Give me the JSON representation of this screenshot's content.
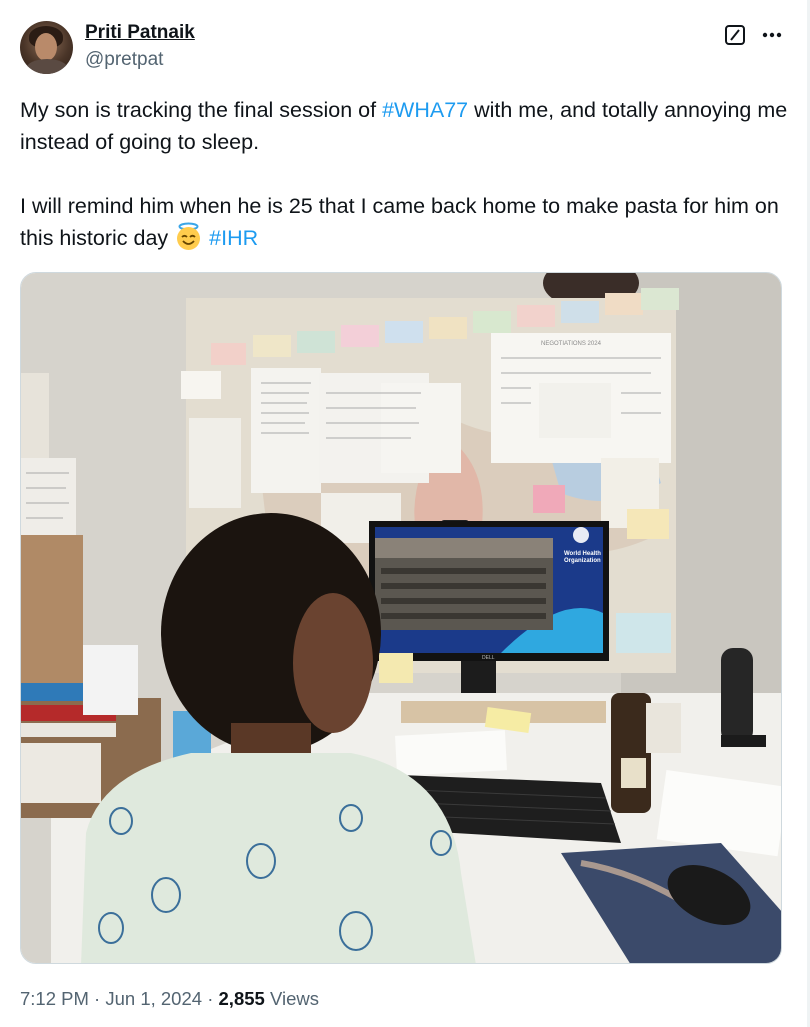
{
  "author": {
    "display_name": "Priti Patnaik",
    "handle": "@pretpat"
  },
  "tweet": {
    "part1": "My son is tracking the final session of ",
    "hashtag1": "#WHA77",
    "part2": " with me, and totally annoying me instead of going to sleep.\n\nI will remind him when he is 25 that I came back home to make pasta for him on this historic day ",
    "emoji": "smiling-face-with-halo",
    "part3": " ",
    "hashtag2": "#IHR"
  },
  "photo": {
    "screen_logo_line1": "World Health",
    "screen_logo_line2": "Organization",
    "notes_header": "NEGOTIATIONS 2024",
    "monitor_brand": "DELL"
  },
  "meta": {
    "time": "7:12 PM",
    "date": "Jun 1, 2024",
    "sep": " · ",
    "views_count": "2,855",
    "views_label": " Views"
  },
  "colors": {
    "link": "#1d9bf0",
    "secondary_text": "#536471",
    "primary_text": "#0f1419",
    "border": "#cfd9de"
  }
}
